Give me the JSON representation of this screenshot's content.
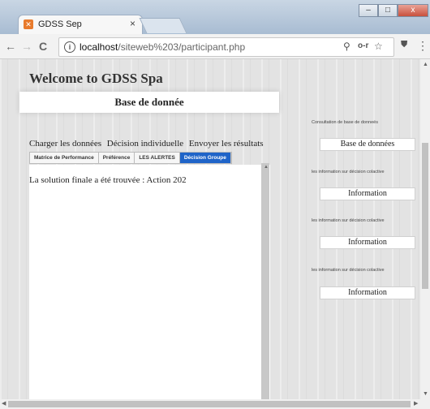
{
  "browser": {
    "tab_title": "GDSS Sep",
    "tab_close": "×",
    "url_host": "localhost",
    "url_path": "/siteweb%203/participant.php",
    "back": "←",
    "forward": "→",
    "reload": "C",
    "info": "i",
    "zoom_icon": "⚲",
    "key_icon": "o-r",
    "star_icon": "☆",
    "menu_icon": "⋮",
    "window_min": "–",
    "window_max": "□",
    "window_close": "x"
  },
  "page": {
    "welcome": "Welcome to GDSS Spa",
    "db_title": "Base de donnée",
    "actions": [
      "Charger les données",
      "Décision individuelle",
      "Envoyer les résultats"
    ],
    "subtabs": [
      "Matrice de Performance",
      "Préférence",
      "LES ALERTES",
      "Décision Groupe"
    ],
    "active_subtab": "Décision Groupe",
    "result_text": "La solution finale a été trouvée : Action 202"
  },
  "sidebar": {
    "consult_label": "Consultation de base de donneés",
    "consult_button": "Base de données",
    "info_label": "les information sur décision colactive",
    "info_button": "Information"
  }
}
